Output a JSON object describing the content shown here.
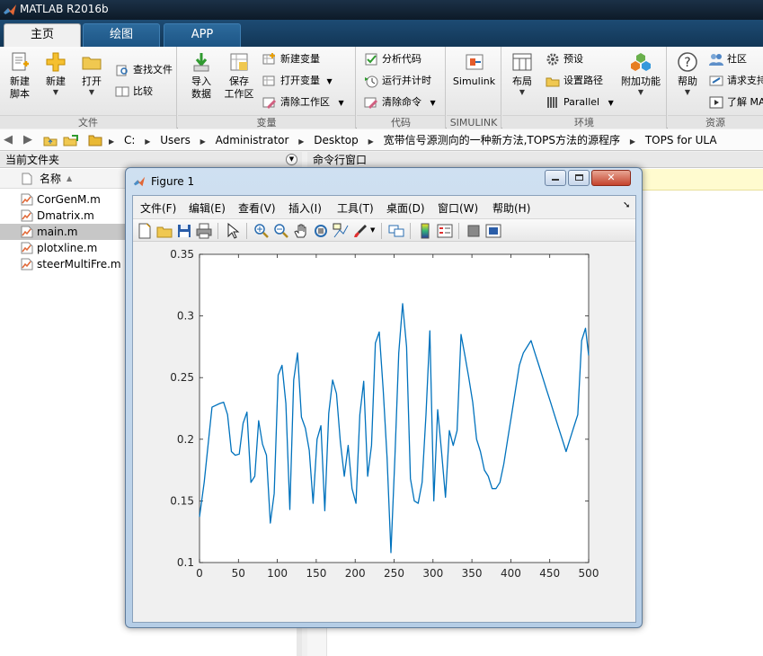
{
  "window": {
    "title": "MATLAB R2016b"
  },
  "ribbon_tabs": [
    "主页",
    "绘图",
    "APP"
  ],
  "ribbon": {
    "file_group": {
      "label": "文件",
      "new_script": "新建\n脚本",
      "new": "新建",
      "open": "打开",
      "find_files": "查找文件",
      "compare": "比较"
    },
    "variable_group": {
      "label": "变量",
      "import": "导入\n数据",
      "save_ws": "保存\n工作区",
      "new_var": "新建变量",
      "open_var": "打开变量",
      "clear_ws": "清除工作区"
    },
    "code_group": {
      "label": "代码",
      "analyze": "分析代码",
      "run_time": "运行并计时",
      "clear_cmd": "清除命令"
    },
    "simulink_group": {
      "label": "SIMULINK",
      "simulink": "Simulink"
    },
    "env_group": {
      "label": "环境",
      "layout": "布局",
      "prefs": "预设",
      "set_path": "设置路径",
      "parallel": "Parallel",
      "addons": "附加功能"
    },
    "resources_group": {
      "label": "资源",
      "help": "帮助",
      "community": "社区",
      "support": "请求支持",
      "learn": "了解 MA"
    }
  },
  "address": {
    "crumbs": [
      "C:",
      "Users",
      "Administrator",
      "Desktop",
      "宽带信号源测向的一种新方法,TOPS方法的源程序",
      "TOPS for ULA"
    ]
  },
  "current_folder": {
    "title": "当前文件夹",
    "column_name": "名称",
    "files": [
      {
        "name": "CorGenM.m",
        "selected": false
      },
      {
        "name": "Dmatrix.m",
        "selected": false
      },
      {
        "name": "main.m",
        "selected": true
      },
      {
        "name": "plotxline.m",
        "selected": false
      },
      {
        "name": "steerMultiFre.m",
        "selected": false
      }
    ]
  },
  "command_window": {
    "title": "命令行窗口"
  },
  "figure": {
    "title": "Figure 1",
    "menus": [
      "文件(F)",
      "编辑(E)",
      "查看(V)",
      "插入(I)",
      "工具(T)",
      "桌面(D)",
      "窗口(W)",
      "帮助(H)"
    ],
    "toolbar_icons": [
      "new-figure-icon",
      "open-file-icon",
      "save-icon",
      "print-icon",
      "pointer-icon",
      "zoom-in-icon",
      "zoom-out-icon",
      "pan-hand-icon",
      "rotate-3d-icon",
      "data-cursor-icon",
      "brush-icon",
      "brush-dropdown-icon",
      "link-plot-icon",
      "colorbar-icon",
      "legend-icon",
      "hide-plot-tools-icon",
      "show-plot-tools-icon"
    ]
  },
  "chart_data": {
    "type": "line",
    "title": "",
    "xlabel": "",
    "ylabel": "",
    "xlim": [
      0,
      500
    ],
    "ylim": [
      0.1,
      0.35
    ],
    "xticks": [
      0,
      50,
      100,
      150,
      200,
      250,
      300,
      350,
      400,
      450,
      500
    ],
    "yticks": [
      0.1,
      0.15,
      0.2,
      0.25,
      0.3,
      0.35
    ],
    "ytick_labels": [
      "0.1",
      "0.15",
      "0.2",
      "0.25",
      "0.3",
      "0.35"
    ],
    "grid": false,
    "line_color": "#0072bd",
    "series": [
      {
        "x": [
          0,
          6,
          16,
          26,
          31,
          36,
          41,
          46,
          51,
          56,
          61,
          66,
          71,
          76,
          81,
          86,
          91,
          96,
          101,
          106,
          111,
          116,
          121,
          126,
          131,
          136,
          141,
          146,
          151,
          156,
          161,
          166,
          171,
          176,
          181,
          186,
          191,
          196,
          201,
          206,
          211,
          216,
          221,
          226,
          231,
          236,
          241,
          246,
          251,
          256,
          261,
          266,
          271,
          276,
          281,
          286,
          291,
          296,
          301,
          306,
          311,
          316,
          321,
          326,
          331,
          336,
          341,
          346,
          351,
          356,
          361,
          366,
          371,
          376,
          381,
          386,
          391,
          396,
          401,
          406,
          411,
          416,
          421,
          426,
          431,
          436,
          441,
          446,
          451,
          456,
          461,
          466,
          471,
          476,
          481,
          486,
          491,
          496,
          500
        ],
        "y": [
          0.137,
          0.165,
          0.226,
          0.229,
          0.23,
          0.22,
          0.19,
          0.187,
          0.188,
          0.213,
          0.222,
          0.165,
          0.17,
          0.215,
          0.196,
          0.187,
          0.132,
          0.156,
          0.252,
          0.26,
          0.229,
          0.143,
          0.248,
          0.27,
          0.218,
          0.209,
          0.191,
          0.148,
          0.2,
          0.211,
          0.142,
          0.221,
          0.248,
          0.237,
          0.198,
          0.17,
          0.195,
          0.16,
          0.148,
          0.22,
          0.247,
          0.17,
          0.195,
          0.278,
          0.287,
          0.24,
          0.185,
          0.108,
          0.185,
          0.27,
          0.31,
          0.275,
          0.168,
          0.15,
          0.148,
          0.165,
          0.22,
          0.288,
          0.15,
          0.224,
          0.19,
          0.153,
          0.207,
          0.195,
          0.207,
          0.285,
          0.268,
          0.25,
          0.23,
          0.2,
          0.19,
          0.175,
          0.17,
          0.16,
          0.16,
          0.165,
          0.18,
          0.2,
          0.22,
          0.24,
          0.26,
          0.27,
          0.275,
          0.28,
          0.27,
          0.26,
          0.25,
          0.24,
          0.23,
          0.22,
          0.21,
          0.2,
          0.19,
          0.2,
          0.21,
          0.22,
          0.28,
          0.29,
          0.268
        ]
      }
    ]
  }
}
